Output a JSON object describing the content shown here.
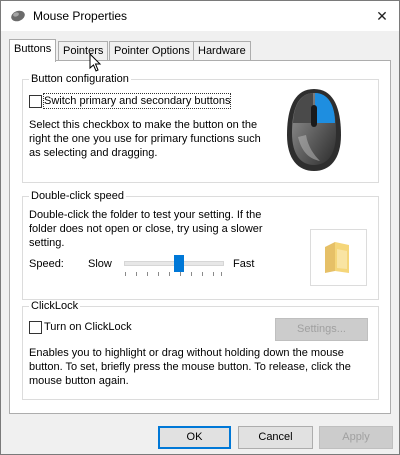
{
  "window": {
    "title": "Mouse Properties",
    "close_glyph": "✕"
  },
  "tabs": [
    {
      "label": "Buttons",
      "active": true
    },
    {
      "label": "Pointers",
      "active": false
    },
    {
      "label": "Pointer Options",
      "active": false
    },
    {
      "label": "Hardware",
      "active": false
    }
  ],
  "button_config": {
    "title": "Button configuration",
    "checkbox_label": "Switch primary and secondary buttons",
    "checked": false,
    "description_lines": [
      "Select this checkbox to make the button on the",
      "right the one you use for primary functions such",
      "as selecting and dragging."
    ]
  },
  "double_click": {
    "title": "Double-click speed",
    "description_lines": [
      "Double-click the folder to test your setting. If the",
      "folder does not open or close, try using a slower",
      "setting."
    ],
    "speed_label": "Speed:",
    "slow_label": "Slow",
    "fast_label": "Fast",
    "speed_fraction": 0.55
  },
  "clicklock": {
    "title": "ClickLock",
    "checkbox_label": "Turn on ClickLock",
    "checked": false,
    "settings_button": "Settings...",
    "description_lines": [
      "Enables you to highlight or drag without holding down the mouse",
      "button. To set, briefly press the mouse button. To release, click the",
      "mouse button again."
    ]
  },
  "footer": {
    "ok": "OK",
    "cancel": "Cancel",
    "apply": "Apply"
  },
  "colors": {
    "accent": "#0078d7",
    "folder": "#f5d67a"
  },
  "icons": [
    "mouse-icon",
    "close-icon",
    "mouse-illustration-icon",
    "folder-icon",
    "cursor-icon"
  ]
}
